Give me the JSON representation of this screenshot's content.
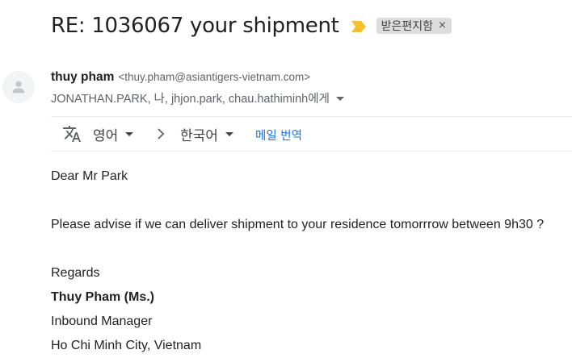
{
  "email": {
    "subject": "RE: 1036067 your shipment",
    "label": "받은편지함",
    "label_remove": "×",
    "sender": {
      "name": "thuy pham",
      "email": "<thuy.pham@asiantigers-vietnam.com>"
    },
    "recipients": "JONATHAN.PARK, 나, jhjon.park, chau.hathiminh에게"
  },
  "translate": {
    "source_lang": "영어",
    "target_lang": "한국어",
    "translate_link": "메일 번역"
  },
  "body": {
    "greeting": "Dear Mr Park",
    "message": "Please advise if we can deliver shipment to your residence tomorrrow between 9h30 ?",
    "closing": "Regards",
    "sig_name": "Thuy Pham (Ms.)",
    "sig_title": "Inbound Manager",
    "sig_location": "Ho Chi Minh City, Vietnam"
  },
  "colors": {
    "importance_marker": "#f6c026",
    "link": "#1a73e8",
    "label_bg": "#dddddd"
  },
  "icons": [
    "important-marker-icon",
    "close-icon",
    "person-avatar-icon",
    "chevron-down-icon",
    "translate-icon",
    "chevron-right-icon"
  ]
}
